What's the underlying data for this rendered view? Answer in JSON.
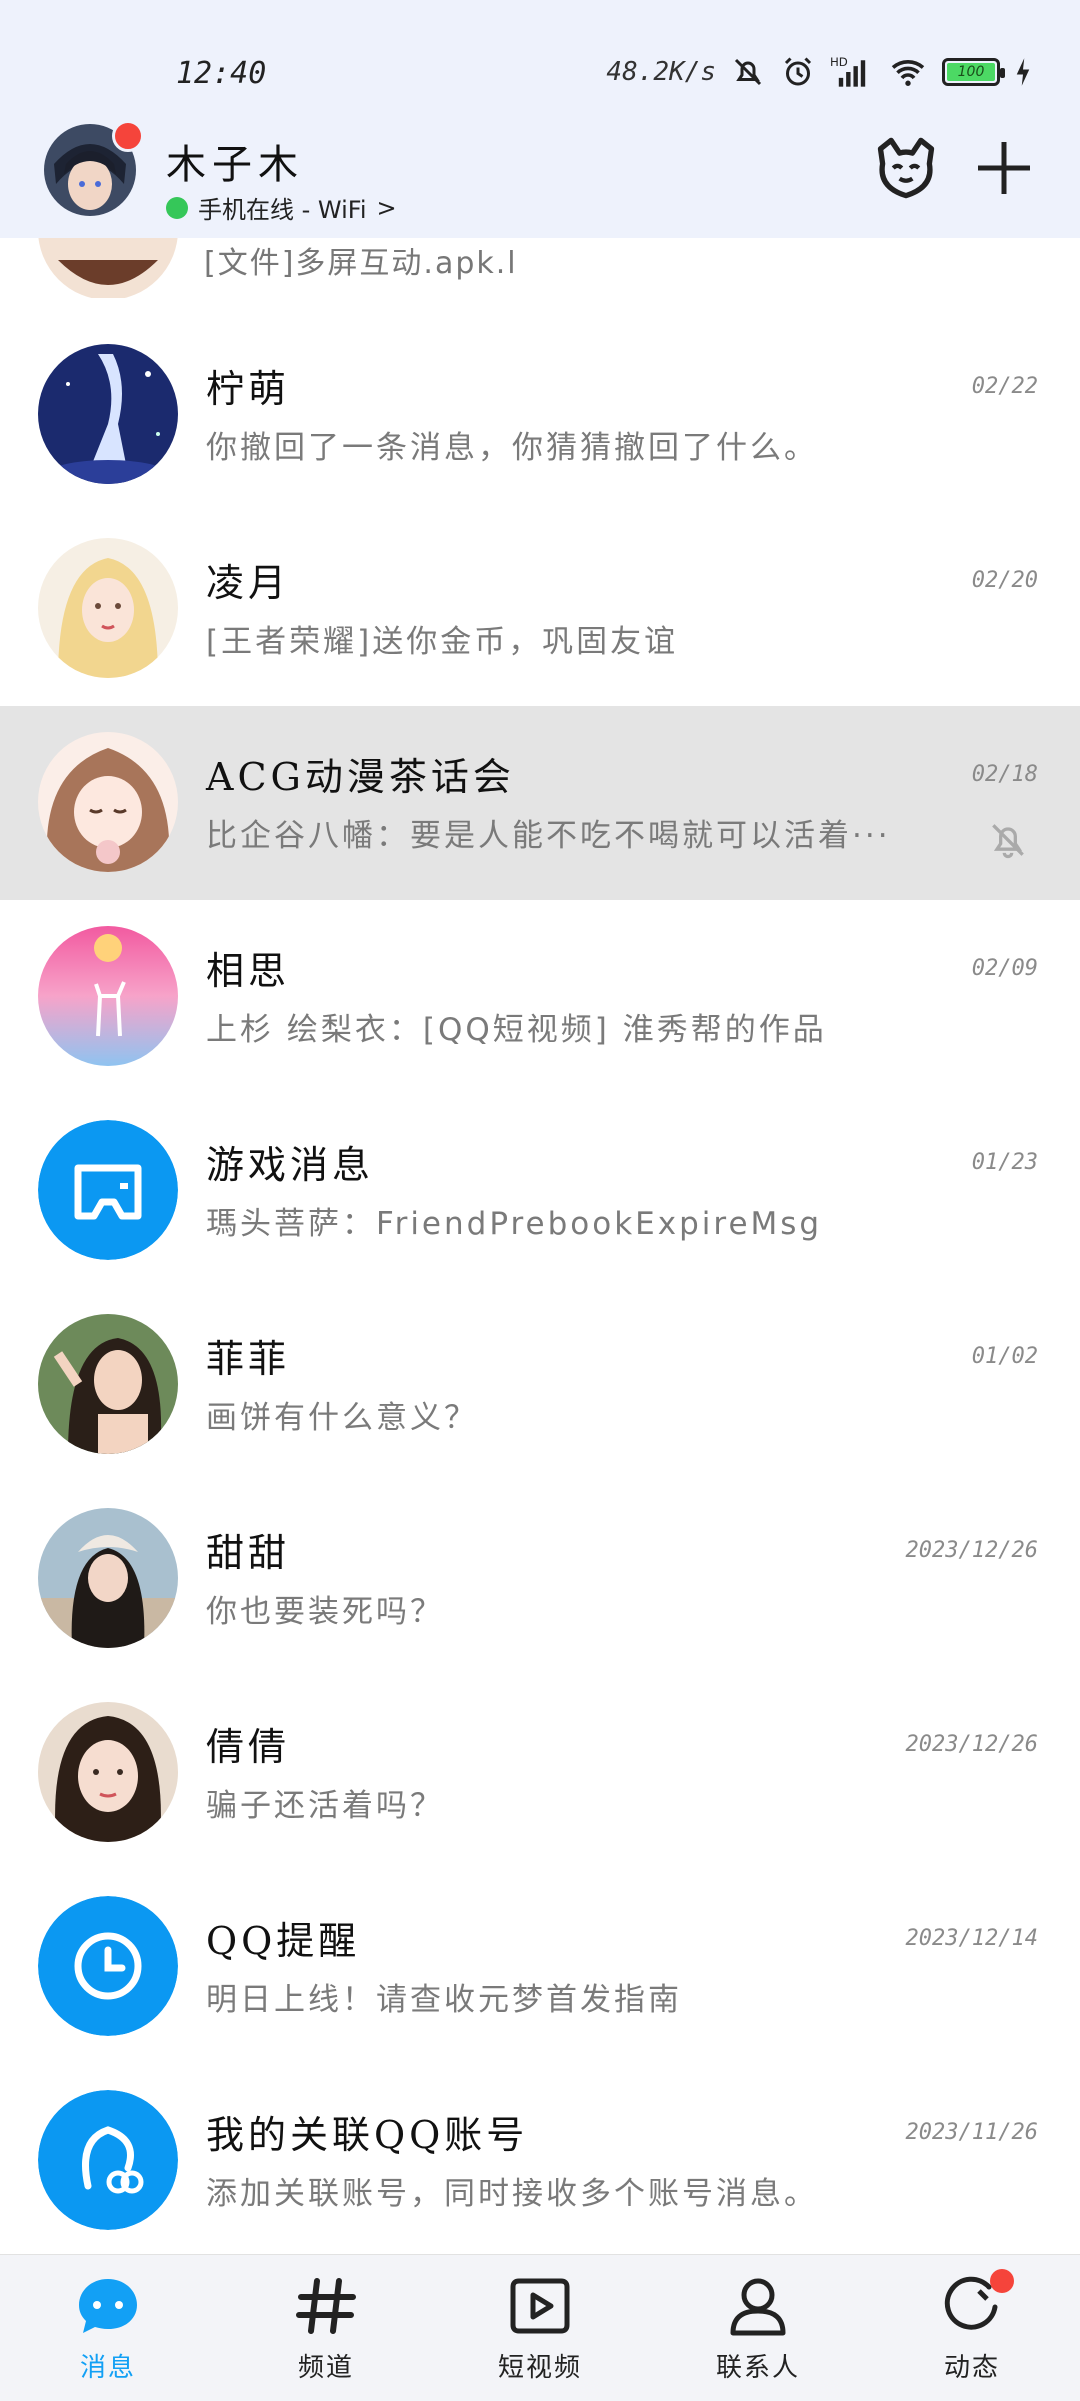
{
  "status_bar": {
    "time": "12:40",
    "net_speed": "48.2K/s",
    "battery": "100"
  },
  "header": {
    "user_name": "木子木",
    "online_status": "手机在线 - WiFi"
  },
  "partial_row": {
    "preview": "[文件]多屏互动.apk.l"
  },
  "conversations": [
    {
      "title": "柠萌",
      "preview": "你撤回了一条消息，你猜猜撤回了什么。",
      "date": "02/22",
      "muted": false
    },
    {
      "title": "凌月",
      "preview": "[王者荣耀]送你金币，巩固友谊",
      "date": "02/20",
      "muted": false
    },
    {
      "title": "ACG动漫茶话会",
      "preview": "比企谷八幡：要是人能不吃不喝就可以活着···",
      "date": "02/18",
      "muted": true
    },
    {
      "title": "相思",
      "preview": "上杉 绘梨衣：[QQ短视频] 淮秀帮的作品",
      "date": "02/09",
      "muted": false
    },
    {
      "title": "游戏消息",
      "preview": "瑪头菩萨：FriendPrebookExpireMsg",
      "date": "01/23",
      "muted": false
    },
    {
      "title": "菲菲",
      "preview": "画饼有什么意义？",
      "date": "01/02",
      "muted": false
    },
    {
      "title": "甜甜",
      "preview": "你也要装死吗？",
      "date": "2023/12/26",
      "muted": false
    },
    {
      "title": "倩倩",
      "preview": "骗子还活着吗？",
      "date": "2023/12/26",
      "muted": false
    },
    {
      "title": "QQ提醒",
      "preview": "明日上线！请查收元梦首发指南",
      "date": "2023/12/14",
      "muted": false
    },
    {
      "title": "我的关联QQ账号",
      "preview": "添加关联账号，同时接收多个账号消息。",
      "date": "2023/11/26",
      "muted": false
    }
  ],
  "bottom_nav": {
    "items": [
      {
        "label": "消息",
        "icon": "message-icon",
        "active": true
      },
      {
        "label": "频道",
        "icon": "hash-icon",
        "active": false
      },
      {
        "label": "短视频",
        "icon": "video-icon",
        "active": false
      },
      {
        "label": "联系人",
        "icon": "contact-icon",
        "active": false
      },
      {
        "label": "动态",
        "icon": "feed-icon",
        "active": false
      }
    ]
  },
  "colors": {
    "accent": "#12a0f5",
    "badge": "#f5443b",
    "online": "#35c759",
    "header_bg": "#eef2fc"
  }
}
